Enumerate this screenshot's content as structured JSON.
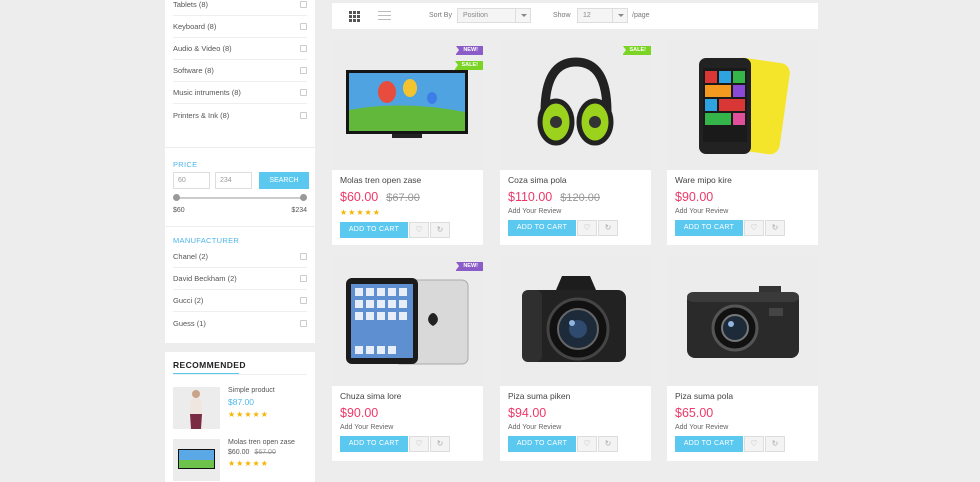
{
  "categories": [
    {
      "label": "Tablets (8)"
    },
    {
      "label": "Keyboard (8)"
    },
    {
      "label": "Audio & Video (8)"
    },
    {
      "label": "Software (8)"
    },
    {
      "label": "Music intruments (8)"
    },
    {
      "label": "Printers & Ink (8)"
    }
  ],
  "price_filter": {
    "title": "PRICE",
    "min_value": "60",
    "max_value": "234",
    "search_label": "SEARCH",
    "min_label": "$60",
    "max_label": "$234"
  },
  "manufacturer": {
    "title": "MANUFACTURER",
    "items": [
      {
        "label": "Chanel (2)"
      },
      {
        "label": "David Beckham (2)"
      },
      {
        "label": "Gucci (2)"
      },
      {
        "label": "Guess (1)"
      }
    ]
  },
  "recommended": {
    "title": "RECOMMENDED",
    "items": [
      {
        "name": "Simple product",
        "price": "$87.00",
        "stars": "★★★★★"
      },
      {
        "name": "Molas tren open zase",
        "price": "$60.00",
        "old_price": "$67.00",
        "stars": "★★★★★"
      }
    ]
  },
  "toolbar": {
    "sort_label": "Sort By",
    "sort_value": "Position",
    "show_label": "Show",
    "show_value": "12",
    "per_page": "/page"
  },
  "products": [
    {
      "name": "Molas tren open zase",
      "price": "$60.00",
      "old_price": "$67.00",
      "badges": [
        "NEW!",
        "SALE!"
      ],
      "stars": "★★★★★",
      "icon": "tv-icon"
    },
    {
      "name": "Coza sima pola",
      "price": "$110.00",
      "old_price": "$120.00",
      "badges": [
        "SALE!"
      ],
      "review": "Add Your Review",
      "icon": "headphones-icon"
    },
    {
      "name": "Ware mipo kire",
      "price": "$90.00",
      "review": "Add Your Review",
      "icon": "smartphone-icon"
    },
    {
      "name": "Chuza sima lore",
      "price": "$90.00",
      "badges": [
        "NEW!"
      ],
      "review": "Add Your Review",
      "icon": "tablet-icon"
    },
    {
      "name": "Piza suma piken",
      "price": "$94.00",
      "review": "Add Your Review",
      "icon": "dslr-camera-icon"
    },
    {
      "name": "Piza suma pola",
      "price": "$65.00",
      "review": "Add Your Review",
      "icon": "compact-camera-icon"
    }
  ],
  "add_to_cart_label": "ADD TO CART",
  "colors": {
    "accent": "#5bc8f0",
    "price": "#ee3868",
    "new_badge": "#8b5cc8",
    "sale_badge": "#7bd323",
    "stars": "#f5b400"
  }
}
